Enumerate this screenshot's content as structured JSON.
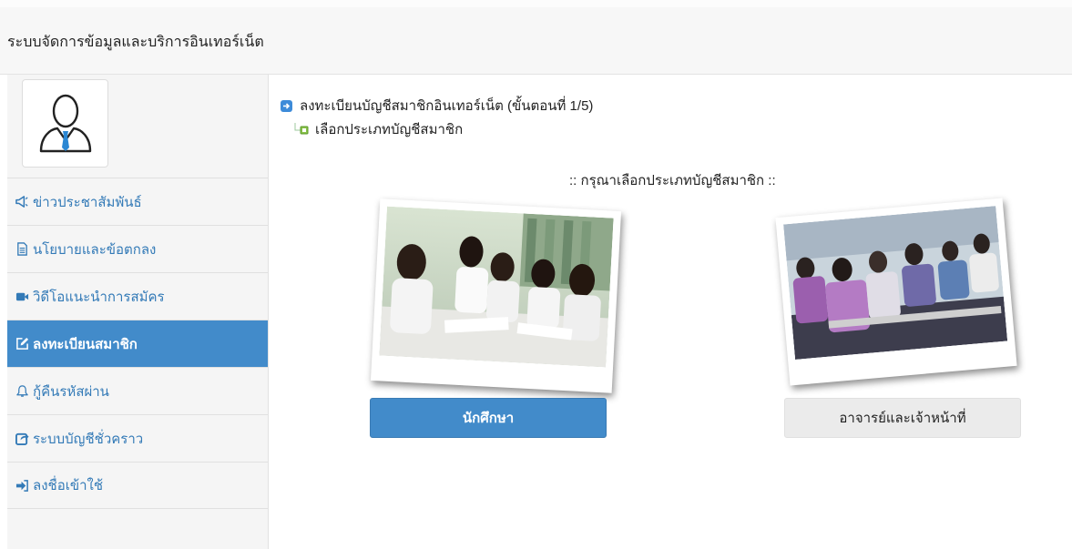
{
  "header": {
    "title": "ระบบจัดการข้อมูลและบริการอินเทอร์เน็ต"
  },
  "sidebar": {
    "avatar_icon": "user-tie-icon",
    "items": [
      {
        "label": "ข่าวประชาสัมพันธ์",
        "icon": "bullhorn-icon",
        "active": false
      },
      {
        "label": "นโยบายและข้อตกลง",
        "icon": "file-text-icon",
        "active": false
      },
      {
        "label": "วิดีโอแนะนำการสมัคร",
        "icon": "video-camera-icon",
        "active": false
      },
      {
        "label": "ลงทะเบียนสมาชิก",
        "icon": "edit-icon",
        "active": true
      },
      {
        "label": "กู้คืนรหัสผ่าน",
        "icon": "bell-icon",
        "active": false
      },
      {
        "label": "ระบบบัญชีชั่วคราว",
        "icon": "share-square-icon",
        "active": false
      },
      {
        "label": "ลงชื่อเข้าใช้",
        "icon": "sign-in-icon",
        "active": false
      }
    ]
  },
  "main": {
    "step_title": "ลงทะเบียนบัญชีสมาชิกอินเทอร์เน็ต (ขั้นตอนที่ 1/5)",
    "substep": "เลือกประเภทบัญชีสมาชิก",
    "prompt": ":: กรุณาเลือกประเภทบัญชีสมาชิก ::",
    "options": [
      {
        "label": "นักศึกษา"
      },
      {
        "label": "อาจารย์และเจ้าหน้าที่"
      }
    ]
  },
  "colors": {
    "accent": "#428bca",
    "link": "#337ab7",
    "sidebar_bg": "#f5f5f5"
  }
}
